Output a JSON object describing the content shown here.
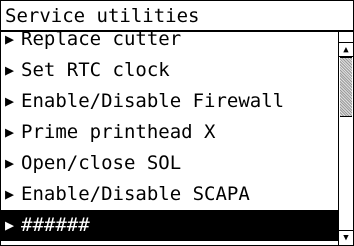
{
  "title": "Service utilities",
  "menu": {
    "items": [
      {
        "label": "Replace cutter",
        "arrow": "▶"
      },
      {
        "label": "Set RTC clock",
        "arrow": "▶"
      },
      {
        "label": "Enable/Disable Firewall",
        "arrow": "▶"
      },
      {
        "label": "Prime printhead X",
        "arrow": "▶"
      },
      {
        "label": "Open/close SOL",
        "arrow": "▶"
      },
      {
        "label": "Enable/Disable SCAPA",
        "arrow": "▶"
      },
      {
        "label": "######",
        "arrow": "▶"
      }
    ],
    "selected_item": "######"
  },
  "scrollbar": {
    "up_icon": "▲",
    "down_icon": "▼",
    "position": 0.45
  },
  "colors": {
    "background": "#ffffff",
    "text": "#000000",
    "selection": "#000000",
    "selected_text": "#ffffff"
  }
}
